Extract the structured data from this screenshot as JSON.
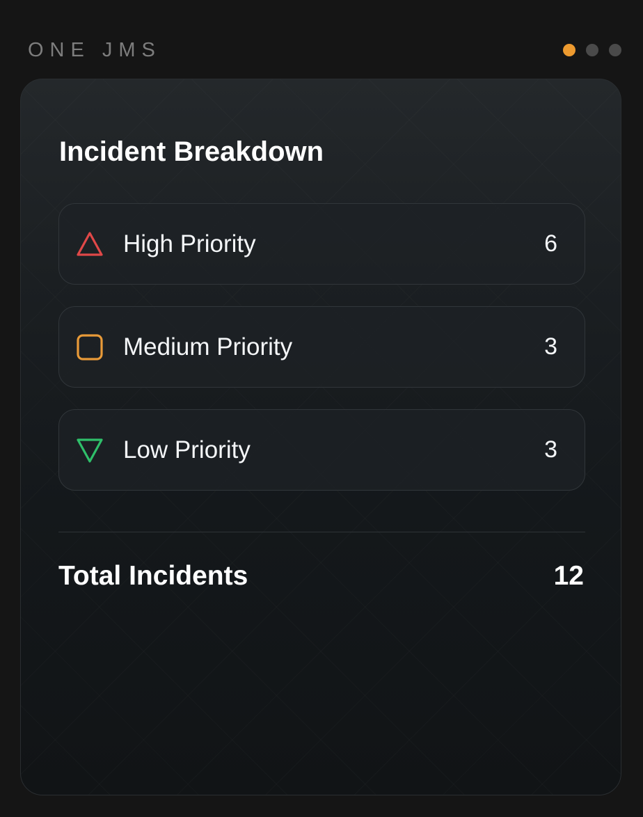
{
  "header": {
    "brand": "ONE JMS",
    "pager": {
      "count": 3,
      "active_index": 0,
      "active_color": "#ed9a2f",
      "inactive_color": "#4a4a4a"
    }
  },
  "card": {
    "title": "Incident Breakdown",
    "items": [
      {
        "label": "High Priority",
        "count": "6",
        "icon": "triangle-up-icon",
        "color": "#e04848"
      },
      {
        "label": "Medium Priority",
        "count": "3",
        "icon": "rounded-square-icon",
        "color": "#e89a38"
      },
      {
        "label": "Low Priority",
        "count": "3",
        "icon": "triangle-down-icon",
        "color": "#2fbf6a"
      }
    ],
    "total": {
      "label": "Total Incidents",
      "value": "12"
    }
  }
}
